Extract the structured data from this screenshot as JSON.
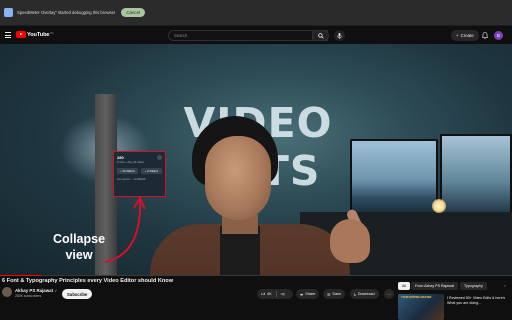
{
  "debug_bar": {
    "message": "SpeedMeter Overlay\" started debugging this browser",
    "cancel_label": "Cancel"
  },
  "masthead": {
    "logo_text": "YouTube",
    "logo_country": "IN",
    "search_placeholder": "Search",
    "create_label": "Create",
    "avatar_letter": "B",
    "icons": [
      "menu-icon",
      "search-icon",
      "mic-icon",
      "plus-icon",
      "bell-icon"
    ]
  },
  "player": {
    "overlay_title": "VIDEO CUTS",
    "mini_card": {
      "number": "280",
      "subtitle": "8 mins + day (10 video)",
      "btn_a": "+ 300 REELS",
      "btn_b": "+ 10 REELS",
      "footer": "one second → +3 ANIMAS"
    },
    "collapse_line1": "Collapse",
    "collapse_line2": "view",
    "progress": 0.08,
    "accent": "#ff0000"
  },
  "video": {
    "title": "6 Font & Typography Principles every Video Editor should Know",
    "channel_name": "Akhay PS Rajawat",
    "channel_badge": "✓",
    "subscribers": "280K subscribers",
    "subscribe_label": "Subscribe",
    "likes": "4K",
    "share_label": "Share",
    "save_label": "Save",
    "download_label": "Download"
  },
  "recommendations": {
    "chips": [
      "All",
      "From Akhay PS Rajawat",
      "Typography"
    ],
    "item": {
      "thumb_text": "YOUR EDITING MASTER",
      "title": "I Reviewed 50+ Video Edits & here's What you are doing..."
    }
  }
}
